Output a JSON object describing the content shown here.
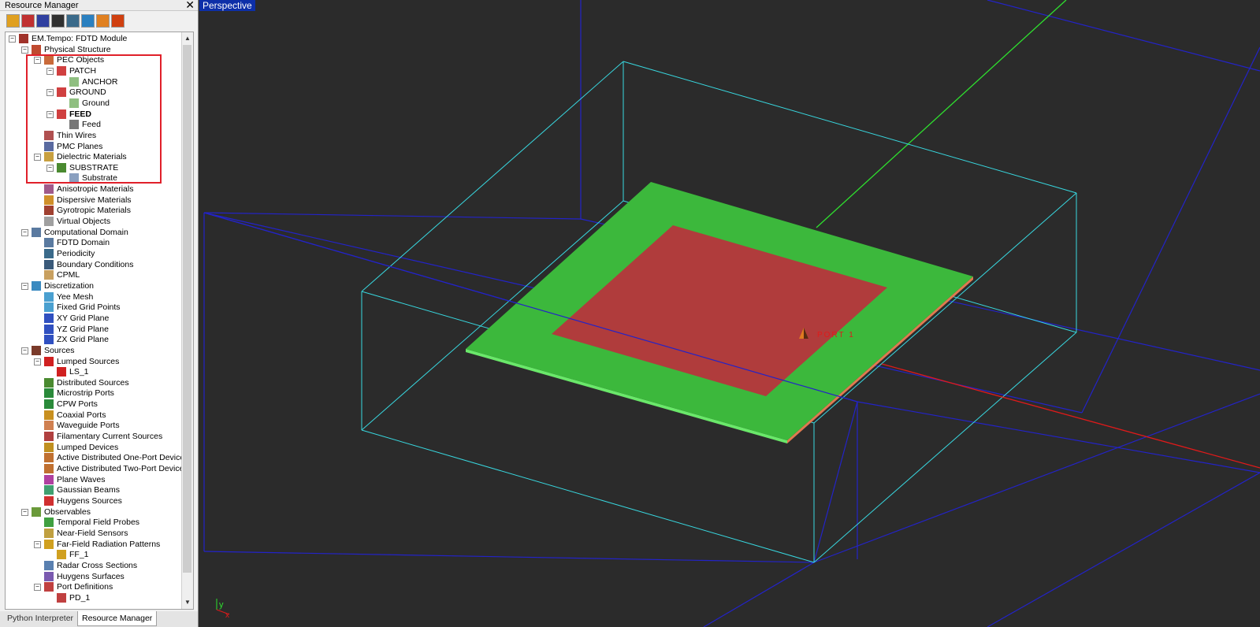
{
  "panel": {
    "title": "Resource Manager",
    "close_glyph": "✕"
  },
  "toolbar": {
    "icons": [
      "script-icon",
      "materials-icon",
      "chart-icon",
      "plot-icon",
      "geometry-icon",
      "wizard-icon",
      "transform-icon",
      "antenna-icon"
    ]
  },
  "tree": [
    {
      "label": "EM.Tempo: FDTD Module",
      "level": 0,
      "exp": "−",
      "icon": "module-icon",
      "color": "#a0322a"
    },
    {
      "label": "Physical Structure",
      "level": 1,
      "exp": "−",
      "icon": "structure-icon",
      "color": "#c04a30"
    },
    {
      "label": "PEC Objects",
      "level": 2,
      "exp": "−",
      "icon": "pec-icon",
      "color": "#c96a3a"
    },
    {
      "label": "PATCH",
      "level": 3,
      "exp": "−",
      "icon": "group-icon",
      "color": "#d04040"
    },
    {
      "label": "ANCHOR",
      "level": 4,
      "icon": "surface-icon",
      "color": "#8fbf80"
    },
    {
      "label": "GROUND",
      "level": 3,
      "exp": "−",
      "icon": "group-icon",
      "color": "#d04040"
    },
    {
      "label": "Ground",
      "level": 4,
      "icon": "surface-icon",
      "color": "#8fbf80"
    },
    {
      "label": "FEED",
      "level": 3,
      "exp": "−",
      "icon": "group-icon",
      "color": "#d04040",
      "bold": true
    },
    {
      "label": "Feed",
      "level": 4,
      "icon": "line-icon",
      "color": "#777777"
    },
    {
      "label": "Thin Wires",
      "level": 2,
      "icon": "wire-icon",
      "color": "#b05050"
    },
    {
      "label": "PMC Planes",
      "level": 2,
      "icon": "pmc-icon",
      "color": "#5a6aa0"
    },
    {
      "label": "Dielectric Materials",
      "level": 2,
      "exp": "−",
      "icon": "dielectric-icon",
      "color": "#c8a040"
    },
    {
      "label": "SUBSTRATE",
      "level": 3,
      "exp": "−",
      "icon": "group-icon",
      "color": "#4a8a30"
    },
    {
      "label": "Substrate",
      "level": 4,
      "icon": "box-icon",
      "color": "#8aa0c0"
    },
    {
      "label": "Anisotropic Materials",
      "level": 2,
      "icon": "anisotropic-icon",
      "color": "#a05a8a"
    },
    {
      "label": "Dispersive Materials",
      "level": 2,
      "icon": "dispersive-icon",
      "color": "#d0902a"
    },
    {
      "label": "Gyrotropic Materials",
      "level": 2,
      "icon": "gyrotropic-icon",
      "color": "#a04030"
    },
    {
      "label": "Virtual Objects",
      "level": 2,
      "icon": "virtual-icon",
      "color": "#a0a0a0"
    },
    {
      "label": "Computational Domain",
      "level": 1,
      "exp": "−",
      "icon": "domain-icon",
      "color": "#5a7aa0"
    },
    {
      "label": "FDTD Domain",
      "level": 2,
      "icon": "fdtd-domain-icon",
      "color": "#5a7aa0"
    },
    {
      "label": "Periodicity",
      "level": 2,
      "icon": "periodicity-icon",
      "color": "#3a6a8a"
    },
    {
      "label": "Boundary Conditions",
      "level": 2,
      "icon": "boundary-icon",
      "color": "#3a5a7a"
    },
    {
      "label": "CPML",
      "level": 2,
      "icon": "cpml-icon",
      "color": "#c8a060"
    },
    {
      "label": "Discretization",
      "level": 1,
      "exp": "−",
      "icon": "mesh-icon",
      "color": "#3a8ac0"
    },
    {
      "label": "Yee Mesh",
      "level": 2,
      "icon": "yee-mesh-icon",
      "color": "#4aa0d0"
    },
    {
      "label": "Fixed Grid Points",
      "level": 2,
      "icon": "grid-points-icon",
      "color": "#4aa0d0"
    },
    {
      "label": "XY Grid Plane",
      "level": 2,
      "icon": "axes-icon",
      "color": "#3050c0"
    },
    {
      "label": "YZ Grid Plane",
      "level": 2,
      "icon": "axes-icon",
      "color": "#3050c0"
    },
    {
      "label": "ZX Grid Plane",
      "level": 2,
      "icon": "axes-icon",
      "color": "#3050c0"
    },
    {
      "label": "Sources",
      "level": 1,
      "exp": "−",
      "icon": "sources-icon",
      "color": "#7a3a2a"
    },
    {
      "label": "Lumped Sources",
      "level": 2,
      "exp": "−",
      "icon": "lumped-source-icon",
      "color": "#d02020"
    },
    {
      "label": "LS_1",
      "level": 3,
      "icon": "lumped-source-icon",
      "color": "#d02020"
    },
    {
      "label": "Distributed Sources",
      "level": 2,
      "icon": "distributed-icon",
      "color": "#4a8a30"
    },
    {
      "label": "Microstrip Ports",
      "level": 2,
      "icon": "microstrip-icon",
      "color": "#2a8a3a"
    },
    {
      "label": "CPW Ports",
      "level": 2,
      "icon": "cpw-icon",
      "color": "#2a8a3a"
    },
    {
      "label": "Coaxial Ports",
      "level": 2,
      "icon": "coax-icon",
      "color": "#c89020"
    },
    {
      "label": "Waveguide Ports",
      "level": 2,
      "icon": "waveguide-icon",
      "color": "#d08050"
    },
    {
      "label": "Filamentary Current Sources",
      "level": 2,
      "icon": "filament-icon",
      "color": "#b04040"
    },
    {
      "label": "Lumped Devices",
      "level": 2,
      "icon": "device-icon",
      "color": "#c09020"
    },
    {
      "label": "Active Distributed One-Port Devices",
      "level": 2,
      "icon": "active-one-port-icon",
      "color": "#c07030"
    },
    {
      "label": "Active Distributed Two-Port Devices",
      "level": 2,
      "icon": "active-two-port-icon",
      "color": "#c07030"
    },
    {
      "label": "Plane Waves",
      "level": 2,
      "icon": "plane-wave-icon",
      "color": "#b040a0"
    },
    {
      "label": "Gaussian Beams",
      "level": 2,
      "icon": "gaussian-beam-icon",
      "color": "#40a070"
    },
    {
      "label": "Huygens Sources",
      "level": 2,
      "icon": "huygens-source-icon",
      "color": "#d03030"
    },
    {
      "label": "Observables",
      "level": 1,
      "exp": "−",
      "icon": "observables-icon",
      "color": "#6a9a3a"
    },
    {
      "label": "Temporal Field Probes",
      "level": 2,
      "icon": "probe-icon",
      "color": "#40a040"
    },
    {
      "label": "Near-Field Sensors",
      "level": 2,
      "icon": "sensor-icon",
      "color": "#c0a040"
    },
    {
      "label": "Far-Field Radiation Patterns",
      "level": 2,
      "exp": "−",
      "icon": "far-field-icon",
      "color": "#d0a020"
    },
    {
      "label": "FF_1",
      "level": 3,
      "icon": "far-field-icon",
      "color": "#d0a020"
    },
    {
      "label": "Radar Cross Sections",
      "level": 2,
      "icon": "rcs-icon",
      "color": "#5a80b0"
    },
    {
      "label": "Huygens Surfaces",
      "level": 2,
      "icon": "huygens-surface-icon",
      "color": "#7a5ab0"
    },
    {
      "label": "Port Definitions",
      "level": 2,
      "exp": "−",
      "icon": "port-def-icon",
      "color": "#c04040"
    },
    {
      "label": "PD_1",
      "level": 3,
      "icon": "port-def-icon",
      "color": "#c04040"
    }
  ],
  "tabs": {
    "python": "Python Interpreter",
    "resource": "Resource Manager"
  },
  "viewport": {
    "label": "Perspective",
    "port_label": "PORT 1",
    "axis_y": "y",
    "axis_x": "x",
    "colors": {
      "background": "#2b2b2b",
      "outer_box": "#2323c8",
      "inner_box": "#38d8e0",
      "ground": "#3cb83c",
      "patch": "#b03c3c",
      "x_axis": "#e01a1a",
      "y_axis": "#2ee02e"
    }
  }
}
